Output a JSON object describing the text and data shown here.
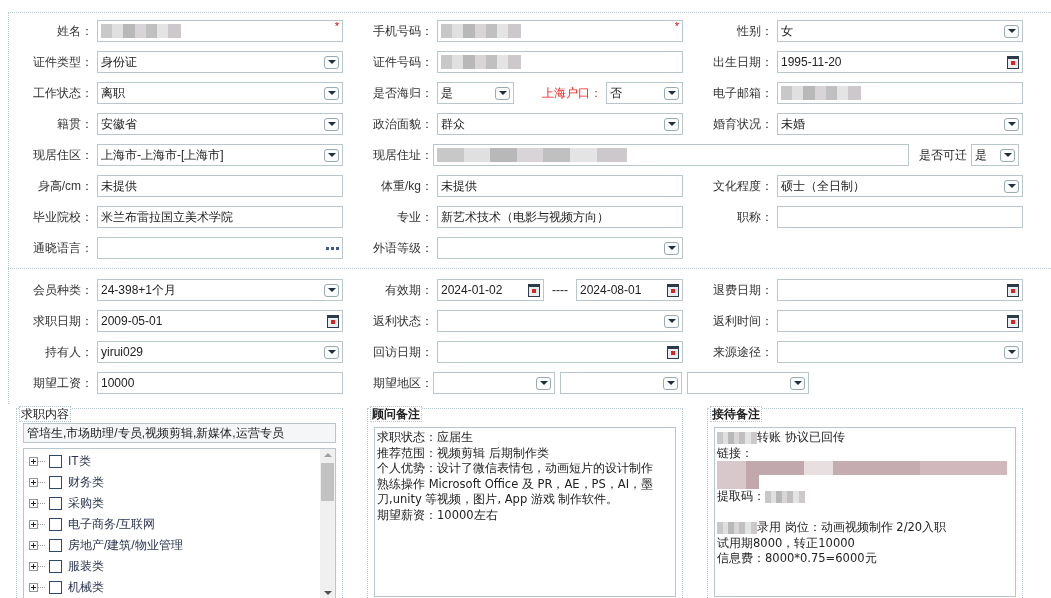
{
  "personal": {
    "rows": [
      [
        {
          "label": "姓名：",
          "controls": [
            {
              "kind": "text",
              "masked": true,
              "mark": "*"
            }
          ]
        },
        {
          "label": "手机号码：",
          "controls": [
            {
              "kind": "text",
              "masked": true,
              "mark": "*"
            }
          ]
        },
        {
          "label": "性别：",
          "controls": [
            {
              "kind": "select",
              "value": "女"
            }
          ]
        }
      ],
      [
        {
          "label": "证件类型：",
          "controls": [
            {
              "kind": "select",
              "value": "身份证"
            }
          ]
        },
        {
          "label": "证件号码：",
          "controls": [
            {
              "kind": "text",
              "masked": true
            }
          ]
        },
        {
          "label": "出生日期：",
          "controls": [
            {
              "kind": "date",
              "value": "1995-11-20"
            }
          ]
        }
      ],
      [
        {
          "label": "工作状态：",
          "controls": [
            {
              "kind": "select",
              "value": "离职"
            }
          ]
        },
        {
          "label": "是否海归：",
          "controls": [
            {
              "kind": "select",
              "value": "是"
            },
            {
              "kind": "label",
              "text": "上海户口：",
              "highlight": true
            },
            {
              "kind": "select",
              "value": "否"
            }
          ]
        },
        {
          "label": "电子邮箱：",
          "controls": [
            {
              "kind": "text",
              "masked": true
            }
          ]
        }
      ],
      [
        {
          "label": "籍贯：",
          "controls": [
            {
              "kind": "select",
              "value": "安徽省"
            }
          ]
        },
        {
          "label": "政治面貌：",
          "controls": [
            {
              "kind": "select",
              "value": "群众"
            }
          ]
        },
        {
          "label": "婚育状况：",
          "controls": [
            {
              "kind": "select",
              "value": "未婚"
            }
          ]
        }
      ],
      [
        {
          "label": "现居住区：",
          "controls": [
            {
              "kind": "select",
              "value": "上海市-上海市-[上海市]"
            }
          ]
        },
        {
          "label": "现居住址：",
          "controls": [
            {
              "kind": "text",
              "masked": true
            },
            {
              "kind": "label",
              "text": "是否可迁",
              "highlight": false
            },
            {
              "kind": "select",
              "value": "是"
            }
          ]
        }
      ],
      [
        {
          "label": "身高/cm：",
          "controls": [
            {
              "kind": "text",
              "value": "未提供"
            }
          ]
        },
        {
          "label": "体重/kg：",
          "controls": [
            {
              "kind": "text",
              "value": "未提供"
            }
          ]
        },
        {
          "label": "文化程度：",
          "controls": [
            {
              "kind": "select",
              "value": "硕士（全日制）"
            }
          ]
        }
      ],
      [
        {
          "label": "毕业院校：",
          "controls": [
            {
              "kind": "text",
              "value": "米兰布雷拉国立美术学院"
            }
          ]
        },
        {
          "label": "专业：",
          "controls": [
            {
              "kind": "text",
              "value": "新艺术技术（电影与视频方向）"
            }
          ]
        },
        {
          "label": "职称：",
          "controls": [
            {
              "kind": "text"
            }
          ]
        }
      ],
      [
        {
          "label": "通晓语言：",
          "controls": [
            {
              "kind": "picker"
            }
          ]
        },
        {
          "label": "外语等级：",
          "controls": [
            {
              "kind": "select"
            }
          ]
        }
      ]
    ]
  },
  "membership": {
    "rows": [
      [
        {
          "label": "会员种类：",
          "controls": [
            {
              "kind": "select",
              "value": "24-398+1个月"
            }
          ]
        },
        {
          "label": "有效期：",
          "controls": [
            {
              "kind": "date",
              "value": "2024-01-02"
            },
            {
              "kind": "separator",
              "text": "----"
            },
            {
              "kind": "date",
              "value": "2024-08-01"
            }
          ]
        },
        {
          "label": "退费日期：",
          "controls": [
            {
              "kind": "date"
            }
          ]
        }
      ],
      [
        {
          "label": "求职日期：",
          "controls": [
            {
              "kind": "date",
              "value": "2009-05-01"
            }
          ]
        },
        {
          "label": "返利状态：",
          "controls": [
            {
              "kind": "select"
            }
          ]
        },
        {
          "label": "返利时间：",
          "controls": [
            {
              "kind": "date"
            }
          ]
        }
      ],
      [
        {
          "label": "持有人：",
          "controls": [
            {
              "kind": "select",
              "value": "yirui029"
            }
          ]
        },
        {
          "label": "回访日期：",
          "controls": [
            {
              "kind": "date"
            }
          ]
        },
        {
          "label": "来源途径：",
          "controls": [
            {
              "kind": "select"
            }
          ]
        }
      ],
      [
        {
          "label": "期望工资：",
          "controls": [
            {
              "kind": "text",
              "value": "10000"
            }
          ]
        },
        {
          "label": "期望地区：",
          "controls": [
            {
              "kind": "select"
            },
            {
              "kind": "select"
            },
            {
              "kind": "select"
            }
          ]
        }
      ]
    ]
  },
  "job_intent": {
    "legend": "求职内容",
    "value": "管培生,市场助理/专员,视频剪辑,新媒体,运营专员",
    "tree": [
      {
        "label": "IT类",
        "checked": false,
        "expanded": false
      },
      {
        "label": "财务类",
        "checked": false,
        "expanded": false
      },
      {
        "label": "采购类",
        "checked": false,
        "expanded": false
      },
      {
        "label": "电子商务/互联网",
        "checked": false,
        "expanded": false
      },
      {
        "label": "房地产/建筑/物业管理",
        "checked": false,
        "expanded": false
      },
      {
        "label": "服装类",
        "checked": false,
        "expanded": false
      },
      {
        "label": "机械类",
        "checked": false,
        "expanded": false
      }
    ]
  },
  "consultant_notes": {
    "legend": "顾问备注",
    "lines": [
      {
        "kind": "text",
        "text": "求职状态：应届生"
      },
      {
        "kind": "text",
        "text": "推荐范围：视频剪辑 后期制作类"
      },
      {
        "kind": "text",
        "text": "个人优势：设计了微信表情包，动画短片的设计制作"
      },
      {
        "kind": "text",
        "text": "熟练操作 Microsoft Office 及 PR，AE，PS，AI，墨刀,unity 等视频，图片, App 游戏 制作软件。"
      },
      {
        "kind": "text",
        "text": "期望薪资：10000左右"
      }
    ]
  },
  "reception_notes": {
    "legend": "接待备注",
    "lines": [
      {
        "kind": "prefixed",
        "text": "转账 协议已回传"
      },
      {
        "kind": "text",
        "text": "链接："
      },
      {
        "kind": "masked"
      },
      {
        "kind": "suffixed",
        "text": "提取码："
      },
      {
        "kind": "blank"
      },
      {
        "kind": "prefixed",
        "text": "录用 岗位：动画视频制作  2/20入职"
      },
      {
        "kind": "text",
        "text": "试用期8000，转正10000"
      },
      {
        "kind": "text",
        "text": "信息费：8000*0.75=6000元"
      }
    ]
  }
}
